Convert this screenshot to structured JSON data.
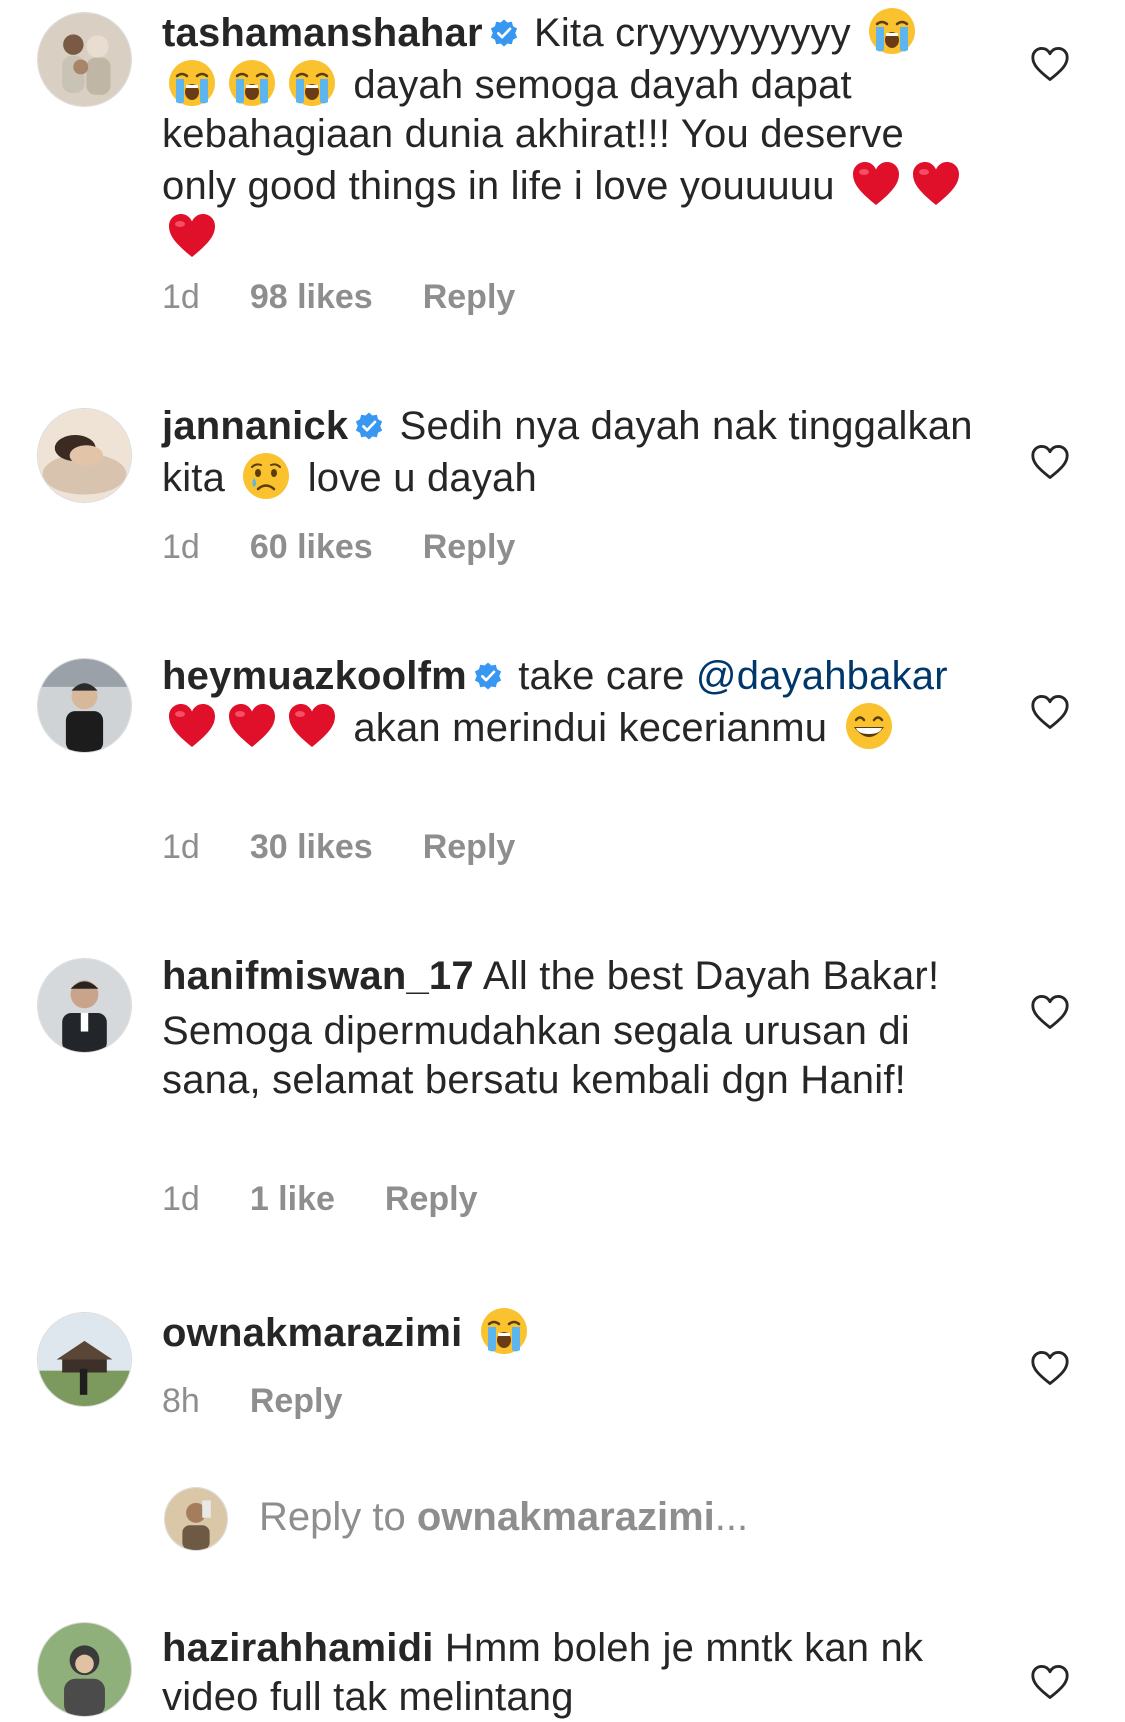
{
  "comments": [
    {
      "username": "tashamanshahar",
      "verified": true,
      "text_1": "Kita cryyyyyyyyyy",
      "text_2": "dayah semoga dayah dapat kebahagiaan dunia akhirat!!! You deserve only good things in life i love youuuuu",
      "time": "1d",
      "likes": "98 likes",
      "reply": "Reply"
    },
    {
      "username": "jannanick",
      "verified": true,
      "text_1": "Sedih nya dayah nak tinggalkan kita",
      "text_2": "love u dayah",
      "time": "1d",
      "likes": "60 likes",
      "reply": "Reply"
    },
    {
      "username": "heymuazkoolfm",
      "verified": true,
      "text_1": "take care",
      "mention": "@dayahbakar",
      "text_2": "akan merindui kecerianmu",
      "time": "1d",
      "likes": "30 likes",
      "reply": "Reply"
    },
    {
      "username": "hanifmiswan_17",
      "verified": false,
      "text_1": "All the best Dayah Bakar!",
      "text_2": "Semoga dipermudahkan segala urusan di sana, selamat bersatu kembali dgn Hanif!",
      "time": "1d",
      "likes": "1 like",
      "reply": "Reply"
    },
    {
      "username": "ownakmarazimi",
      "verified": false,
      "time": "8h",
      "reply": "Reply"
    },
    {
      "username": "hazirahhamidi",
      "verified": false,
      "text_1": "Hmm boleh je mntk kan nk video full tak melintang"
    }
  ],
  "reply_box": {
    "prefix": "Reply to ",
    "target": "ownakmarazimi",
    "suffix": "..."
  },
  "colors": {
    "text": "#262626",
    "meta": "#8e8e8e",
    "mention": "#00376b",
    "verified": "#3897f0",
    "heart_emoji": "#e0102b",
    "face_emoji": "#f9c22e",
    "tear": "#5db5f0"
  },
  "icons": {
    "like": "heart-outline-icon",
    "verified": "verified-badge-icon",
    "emoji_crying": "loudly-crying-face-emoji",
    "emoji_tear": "crying-face-emoji",
    "emoji_heart": "red-heart-emoji",
    "emoji_grin": "grinning-face-emoji"
  }
}
